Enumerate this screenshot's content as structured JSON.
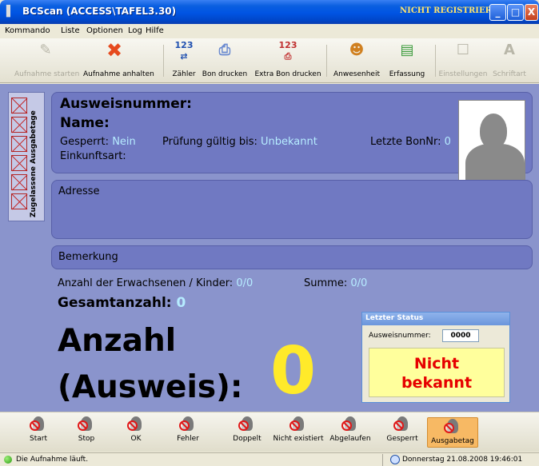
{
  "window": {
    "title": "BCScan (ACCESS\\TAFEL3.30)",
    "registration_status": "NICHT REGISTRIERT",
    "minimize": "_",
    "maximize": "□",
    "close": "X"
  },
  "menu": [
    "Kommando",
    "Liste",
    "Optionen",
    "Log",
    "Hilfe"
  ],
  "toolbar": {
    "start": "Aufnahme starten",
    "stop": "Aufnahme anhalten",
    "counter": "Zähler",
    "print_bon": "Bon drucken",
    "print_extra_bon": "Extra Bon drucken",
    "attendance": "Anwesenheit",
    "capture": "Erfassung",
    "settings": "Einstellungen",
    "font": "Schriftart"
  },
  "side_tab": {
    "label": "Zugelassene Ausgabetage"
  },
  "person": {
    "id_label": "Ausweisnummer:",
    "name_label": "Name:",
    "blocked_label": "Gesperrt:",
    "blocked_value": "Nein",
    "valid_label": "Prüfung gültig bis:",
    "valid_value": "Unbekannt",
    "last_bon_label": "Letzte BonNr:",
    "last_bon_value": "0",
    "income_label": "Einkunftsart:",
    "address_label": "Adresse",
    "remark_label": "Bemerkung"
  },
  "counts": {
    "adults_children_label": "Anzahl der Erwachsenen / Kinder:",
    "adults_children_value": "0/0",
    "sum_label": "Summe:",
    "sum_value": "0/0",
    "total_label": "Gesamtanzahl:",
    "total_value": "0",
    "count_label_line1": "Anzahl",
    "count_label_line2": "(Ausweis):",
    "count_value": "0"
  },
  "last_status": {
    "title": "Letzter Status",
    "id_label": "Ausweisnummer:",
    "id_value": "0000",
    "message_line1": "Nicht",
    "message_line2": "bekannt"
  },
  "buttons": [
    "Start",
    "Stop",
    "OK",
    "Fehler",
    "Doppelt",
    "Nicht existiert",
    "Abgelaufen",
    "Gesperrt",
    "Ausgabetag"
  ],
  "statusbar": {
    "message": "Die Aufnahme läuft.",
    "datetime": "Donnerstag 21.08.2008 19:46:01"
  },
  "colors": {
    "titlebar": "#0054e3",
    "main_background": "#8a94cc",
    "panel": "#7079c2",
    "value_text": "#b6ecff",
    "big_count": "#ffea2a",
    "status_message": "#e60000",
    "status_box": "#ffff9c",
    "active_button": "#f7b964"
  }
}
